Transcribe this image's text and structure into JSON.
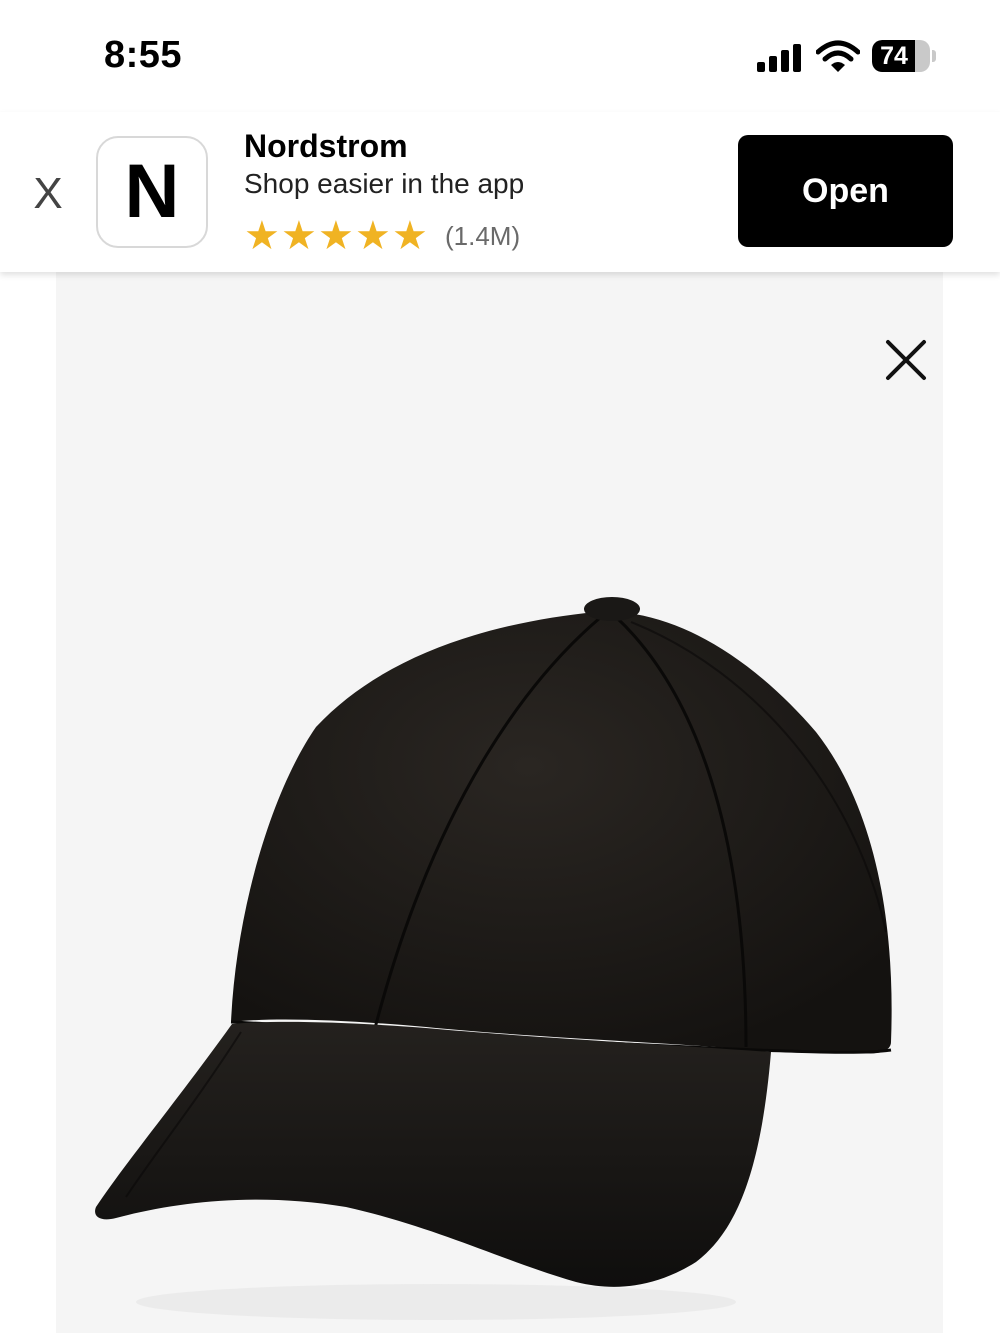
{
  "status_bar": {
    "time": "8:55",
    "battery_level": "74",
    "battery_fraction": 0.74,
    "icons": [
      "cellular-signal-icon",
      "wifi-icon",
      "battery-icon"
    ]
  },
  "app_banner": {
    "close_label": "X",
    "app_icon_letter": "N",
    "app_name": "Nordstrom",
    "tagline": "Shop easier in the app",
    "rating_stars": 5,
    "rating_count": "(1.4M)",
    "open_label": "Open",
    "colors": {
      "star": "#f0b323",
      "button": "#000000"
    }
  },
  "product_view": {
    "background": "#f5f5f5",
    "close_icon": "close-icon",
    "image": "black-baseball-cap"
  }
}
